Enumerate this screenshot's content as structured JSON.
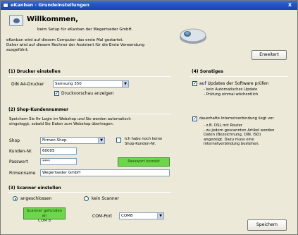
{
  "window": {
    "title": "eKanban - Grundeinstellungen",
    "close_glyph": "x"
  },
  "header": {
    "welcome": "Willkommen,",
    "subtitle": "beim Setup für eKanban der Wegertseder GmbH.",
    "intro_line1": "eKanban wird auf diesem Computer das erste Mal gestartet.",
    "intro_line2": "Daher wird auf diesem Rechner der Assistent für die Erste Verwendung",
    "intro_line3": "ausgeführt.",
    "expert_button": "Erweitert"
  },
  "printer": {
    "title": "(1) Drucker einstellen",
    "label": "DIN A4-Drucker",
    "selected": "Samsung 350",
    "preview_label": "Druckvorschau anzeigen",
    "preview_checked": true
  },
  "shop": {
    "title": "(2) Shop-Kundennummer",
    "description_line1": "Speichern Sie Ihr Login im Webshop und Sie werden automatisch",
    "description_line2": "eingeloggt, sobald Sie Daten zum Webshop übertragen.",
    "shop_label": "Shop",
    "shop_selected": "Firmen-Shop",
    "no_customer_label_line1": "Ich habe noch keine",
    "no_customer_label_line2": "Shop-Kunden-Nr.",
    "customer_no_label": "Kunden-Nr.",
    "customer_no_value": "60005",
    "password_label": "Passwort",
    "password_value": "****",
    "password_status": "Passwort korrekt",
    "company_label": "Firmenname",
    "company_value": "Wegertseder GmbH"
  },
  "scanner": {
    "title": "(3) Scanner einstellen",
    "option_connected": "angeschlossen",
    "option_none": "kein Scanner",
    "found_line1": "Scanner gefunden an",
    "found_line2": "COM 8",
    "com_label": "COM-Port",
    "com_selected": "COM8"
  },
  "other": {
    "title": "(4) Sonstiges",
    "updates_label": "auf Updates der Software prüfen",
    "updates_checked": true,
    "updates_note1": "- kein Automatisches Update",
    "updates_note2": "- Prüfung einmal wöchentlich",
    "internet_label": "dauerhafte Internetverbindung liegt vor",
    "internet_checked": true,
    "internet_note1": "- z.B. DSL mit Router",
    "internet_note2": "- zu jedem gescannten Artikel werden",
    "internet_note3": "Daten (Bezeichnung, DIN, ISO)",
    "internet_note4": "angezeigt. Dazu muss eine",
    "internet_note5": "Internetverbindung bestehen.",
    "save_button": "Speichern"
  },
  "colors": {
    "titlebar": "#2456c4",
    "window_bg": "#ece9d8",
    "success_green": "#6ed64a"
  }
}
